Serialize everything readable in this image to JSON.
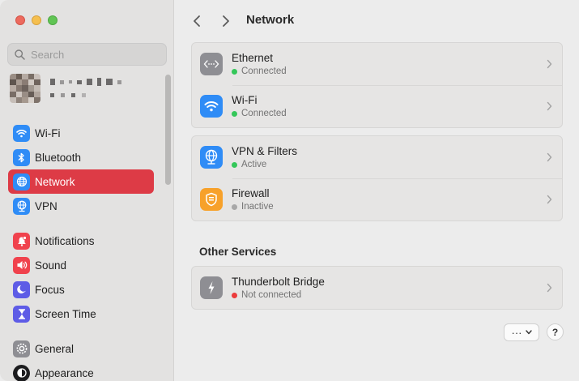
{
  "window": {
    "title": "Network"
  },
  "sidebar": {
    "search_placeholder": "Search",
    "items": [
      {
        "label": "Wi-Fi",
        "icon": "wifi-icon",
        "color": "#2f8cf6",
        "active": false
      },
      {
        "label": "Bluetooth",
        "icon": "bluetooth-icon",
        "color": "#2f8cf6",
        "active": false
      },
      {
        "label": "Network",
        "icon": "globe-icon",
        "color": "#2f8cf6",
        "active": true
      },
      {
        "label": "VPN",
        "icon": "vpn-globe-icon",
        "color": "#2f8cf6",
        "active": false
      },
      {
        "label": "Notifications",
        "icon": "bell-icon",
        "color": "#f0424d",
        "active": false
      },
      {
        "label": "Sound",
        "icon": "speaker-icon",
        "color": "#f0424d",
        "active": false
      },
      {
        "label": "Focus",
        "icon": "moon-icon",
        "color": "#5e5ce6",
        "active": false
      },
      {
        "label": "Screen Time",
        "icon": "hourglass-icon",
        "color": "#5e5ce6",
        "active": false
      },
      {
        "label": "General",
        "icon": "gear-icon",
        "color": "#8e8e93",
        "active": false
      },
      {
        "label": "Appearance",
        "icon": "appearance-icon",
        "color": "#1c1c1e",
        "active": false
      }
    ]
  },
  "main": {
    "nav": {
      "back": "back",
      "forward": "forward"
    },
    "title": "Network",
    "groups": [
      {
        "rows": [
          {
            "title": "Ethernet",
            "status": "Connected",
            "status_color": "#34c759",
            "icon": "ethernet-icon",
            "icon_color": "#8e8e93"
          },
          {
            "title": "Wi-Fi",
            "status": "Connected",
            "status_color": "#34c759",
            "icon": "wifi-icon",
            "icon_color": "#2f8cf6"
          }
        ]
      },
      {
        "rows": [
          {
            "title": "VPN & Filters",
            "status": "Active",
            "status_color": "#34c759",
            "icon": "vpn-globe-icon",
            "icon_color": "#2f8cf6"
          },
          {
            "title": "Firewall",
            "status": "Inactive",
            "status_color": "#a8a8a8",
            "icon": "firewall-shield-icon",
            "icon_color": "#f7a12a"
          }
        ]
      }
    ],
    "other_services": {
      "title": "Other Services",
      "rows": [
        {
          "title": "Thunderbolt Bridge",
          "status": "Not connected",
          "status_color": "#ec3c3c",
          "icon": "thunderbolt-icon",
          "icon_color": "#8e8e93"
        }
      ]
    },
    "footer": {
      "more_label": "···",
      "help_label": "?"
    }
  }
}
